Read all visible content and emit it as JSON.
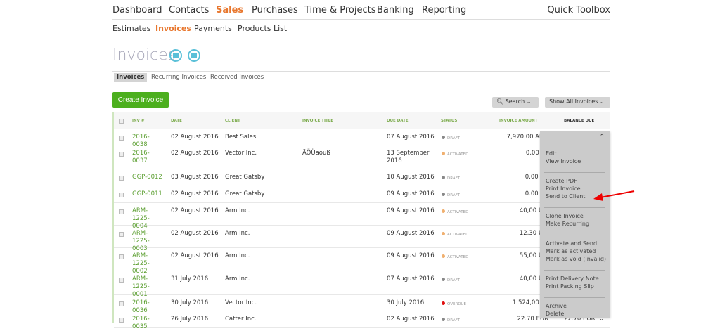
{
  "topnav": [
    "Dashboard",
    "Contacts",
    "Sales",
    "Purchases",
    "Time & Projects",
    "Banking",
    "Reporting"
  ],
  "quick_toolbox": "Quick Toolbox",
  "subnav": [
    "Estimates",
    "Invoices",
    "Payments",
    "Products List"
  ],
  "title": "Invoices",
  "tabs": [
    "Invoices",
    "Recurring Invoices",
    "Received Invoices"
  ],
  "create_label": "Create Invoice",
  "search_label": "Search",
  "filter_label": "Show All Invoices",
  "columns": [
    "INV #",
    "DATE",
    "CLIENT",
    "INVOICE TITLE",
    "DUE DATE",
    "STATUS",
    "INVOICE AMOUNT",
    "BALANCE DUE"
  ],
  "rows": [
    {
      "inv": "2016-0038",
      "date": "02 August 2016",
      "client": "Best Sales",
      "title": "",
      "due": "07 August 2016",
      "status": "DRAFT",
      "amount": "7,970.00 ANG",
      "balance": ""
    },
    {
      "inv": "2016-0037",
      "date": "02 August 2016",
      "client": "Vector Inc.",
      "title": "ÄÖÜäöüß",
      "due": "13 September 2016",
      "status": "ACTIVATED",
      "amount": "0,00 AL",
      "balance": ""
    },
    {
      "inv": "GGP-0012",
      "date": "03 August 2016",
      "client": "Great Gatsby",
      "title": "",
      "due": "10 August 2016",
      "status": "DRAFT",
      "amount": "0.00 EU",
      "balance": ""
    },
    {
      "inv": "GGP-0011",
      "date": "02 August 2016",
      "client": "Great Gatsby",
      "title": "",
      "due": "09 August 2016",
      "status": "DRAFT",
      "amount": "0.00 EU",
      "balance": ""
    },
    {
      "inv": "ARM-1225-0004",
      "date": "02 August 2016",
      "client": "Arm Inc.",
      "title": "",
      "due": "09 August 2016",
      "status": "ACTIVATED",
      "amount": "40,00 USI",
      "balance": ""
    },
    {
      "inv": "ARM-1225-0003",
      "date": "02 August 2016",
      "client": "Arm Inc.",
      "title": "",
      "due": "09 August 2016",
      "status": "ACTIVATED",
      "amount": "12,30 USI",
      "balance": ""
    },
    {
      "inv": "ARM-1225-0002",
      "date": "02 August 2016",
      "client": "Arm Inc.",
      "title": "",
      "due": "09 August 2016",
      "status": "ACTIVATED",
      "amount": "55,00 USI",
      "balance": ""
    },
    {
      "inv": "ARM-1225-0001",
      "date": "31 July 2016",
      "client": "Arm Inc.",
      "title": "",
      "due": "07 August 2016",
      "status": "DRAFT",
      "amount": "40,00 USI",
      "balance": ""
    },
    {
      "inv": "2016-0036",
      "date": "30 July 2016",
      "client": "Vector Inc.",
      "title": "",
      "due": "30 July 2016",
      "status": "OVERDUE",
      "amount": "1.524,00 AL",
      "balance": ""
    },
    {
      "inv": "2016-0035",
      "date": "26 July 2016",
      "client": "Catter Inc.",
      "title": "",
      "due": "02 August 2016",
      "status": "DRAFT",
      "amount": "22.70 EUR",
      "balance": "22.70 EUR"
    }
  ],
  "status_colors": {
    "DRAFT": "#888888",
    "ACTIVATED": "#f0b070",
    "OVERDUE": "#e01010"
  },
  "menu": [
    [
      "Edit",
      "View Invoice"
    ],
    [
      "Create PDF",
      "Print Invoice",
      "Send to Client"
    ],
    [
      "Clone Invoice",
      "Make Recurring"
    ],
    [
      "Activate and Send",
      "Mark as activated",
      "Mark as void (invalid)"
    ],
    [
      "Print Delivery Note",
      "Print Packing Slip"
    ],
    [
      "Archive",
      "Delete"
    ]
  ]
}
